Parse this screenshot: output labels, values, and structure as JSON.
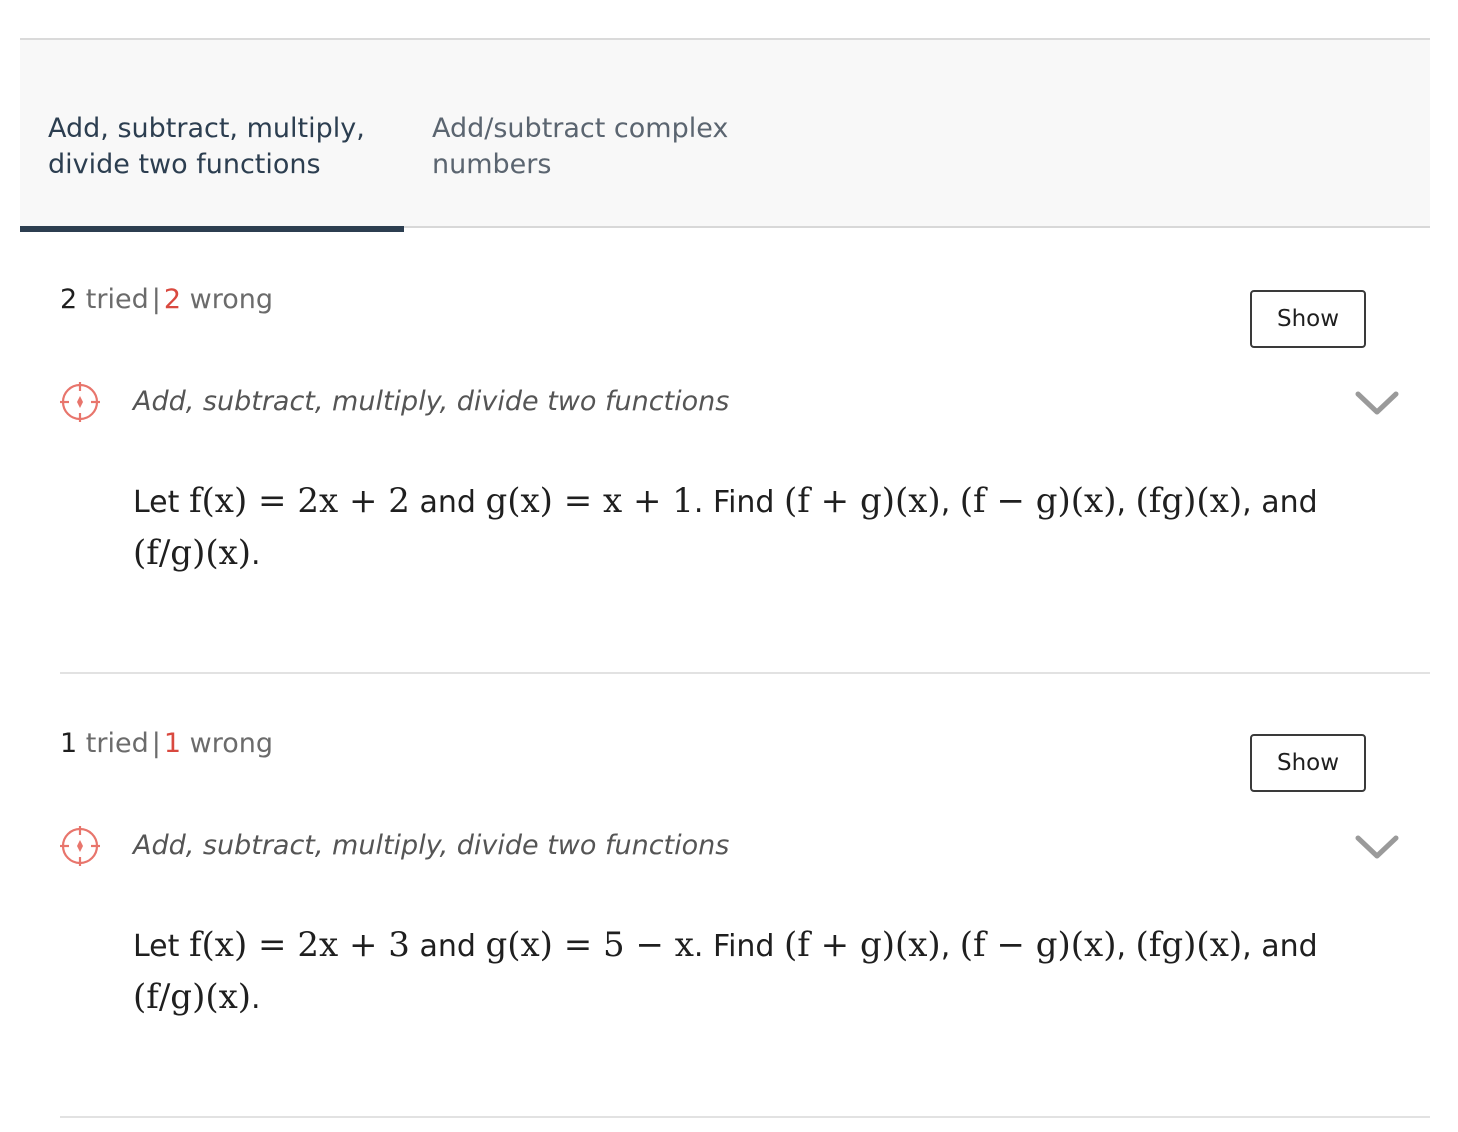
{
  "tabs": [
    {
      "label_line1": "Add, subtract, multiply,",
      "label_line2": "divide two functions",
      "active": true
    },
    {
      "label_line1": "Add/subtract complex",
      "label_line2": "numbers",
      "active": false
    }
  ],
  "problems": [
    {
      "tried_count": "2",
      "tried_label": "tried",
      "separator": "|",
      "wrong_count": "2",
      "wrong_label": "wrong",
      "show_label": "Show",
      "skill": "Add, subtract, multiply, divide two functions",
      "question": {
        "let": "Let",
        "f_def": "f(x) = 2x + 2",
        "and1": "and",
        "g_def": "g(x) = x + 1",
        "find": ". Find",
        "expr1": "(f + g)(x)",
        "expr2": "(f − g)(x)",
        "expr3": "(fg)(x)",
        "and2": ", and",
        "expr4": "(f/g)(x)"
      }
    },
    {
      "tried_count": "1",
      "tried_label": "tried",
      "separator": "|",
      "wrong_count": "1",
      "wrong_label": "wrong",
      "show_label": "Show",
      "skill": "Add, subtract, multiply, divide two functions",
      "question": {
        "let": "Let",
        "f_def": "f(x) = 2x + 3",
        "and1": "and",
        "g_def": "g(x) = 5 − x",
        "find": ". Find",
        "expr1": "(f + g)(x)",
        "expr2": "(f − g)(x)",
        "expr3": "(fg)(x)",
        "and2": ", and",
        "expr4": "(f/g)(x)"
      }
    }
  ],
  "colors": {
    "accent": "#2c3e50",
    "wrong": "#d9493f",
    "target_icon": "#e8756c"
  }
}
